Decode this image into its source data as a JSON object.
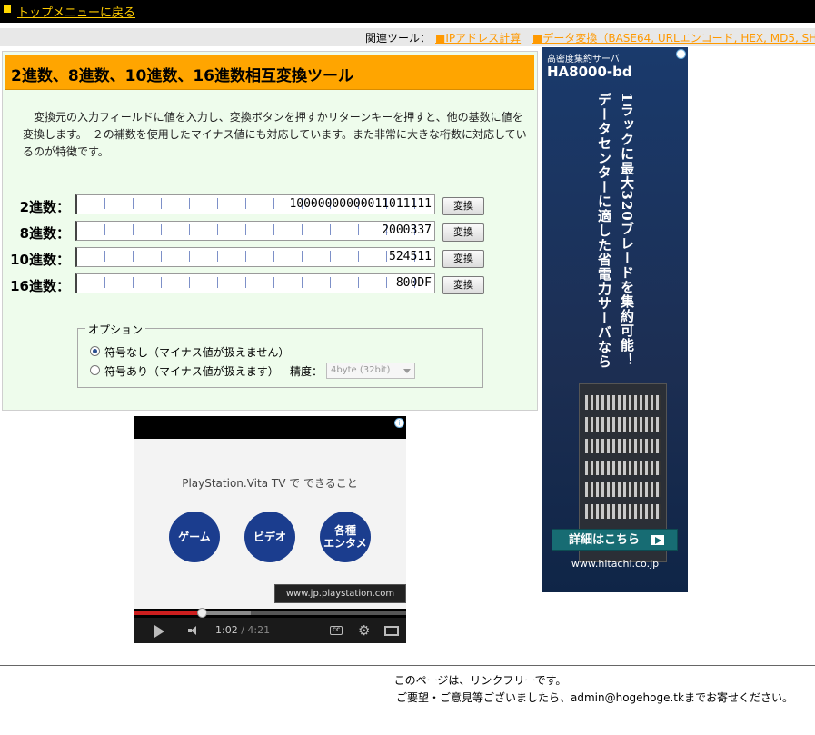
{
  "nav": {
    "top_link": "トップメニューに戻る"
  },
  "related": {
    "label": "関連ツール：",
    "links": [
      "■IPアドレス計算",
      "■データ変換（BASE64, URLエンコード, HEX, MD5, SH"
    ]
  },
  "tool": {
    "title": "2進数、8進数、10進数、16進数相互変換ツール",
    "description": "　変換元の入力フィールドに値を入力し、変換ボタンを押すかリターンキーを押すと、他の基数に値を変換します。　２の補数を使用したマイナス値にも対応しています。また非常に大きな桁数に対応しているのが特徴です。",
    "rows": [
      {
        "label": "2進数：",
        "value": "10000000000011011111",
        "button": "変換"
      },
      {
        "label": "8進数：",
        "value": "2000337",
        "button": "変換"
      },
      {
        "label": "10進数：",
        "value": "524511",
        "button": "変換"
      },
      {
        "label": "16進数：",
        "value": "800DF",
        "button": "変換"
      }
    ],
    "options": {
      "legend": "オプション",
      "unsigned": "符号なし（マイナス値が扱えません）",
      "signed": "符号あり（マイナス値が扱えます）",
      "precision_label": "精度：",
      "precision_value": "4byte (32bit)",
      "selected": "unsigned"
    }
  },
  "ad_right": {
    "subtitle": "高密度集約サーバ",
    "brand": "HA8000-bd",
    "vertical_1": "1ラックに最大320ブレードを集約可能！",
    "vertical_2": "データセンターに適した省電力サーバなら",
    "button": "詳細はこちら",
    "url": "www.hitachi.co.jp"
  },
  "ad_video": {
    "title": "PlayStation.Vita TV で できること",
    "buttons": [
      "ゲーム",
      "ビデオ",
      "各種\nエンタメ"
    ],
    "url": "www.jp.playstation.com",
    "time_current": "1:02",
    "time_total": " / 4:21",
    "progress": 0.25,
    "loaded": 0.43
  },
  "footer": {
    "line1": "このページは、リンクフリーです。",
    "line2": "ご要望・ご意見等ございましたら、admin@hogehoge.tkまでお寄せください。"
  }
}
